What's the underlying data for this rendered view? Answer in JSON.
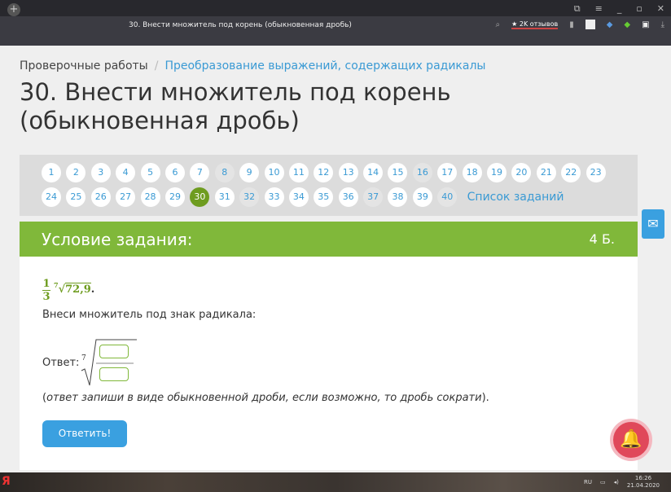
{
  "browser": {
    "tab_title": "30. Внести множитель под корень (обыкновенная дробь)",
    "reviews": "★ 2K отзывов"
  },
  "breadcrumb": {
    "root": "Проверочные работы",
    "current": "Преобразование выражений, содержащих радикалы"
  },
  "title": "30. Внести множитель под корень (обыкновенная дробь)",
  "tasks": {
    "row1": [
      "1",
      "2",
      "3",
      "4",
      "5",
      "6",
      "7",
      "8",
      "9",
      "10",
      "11",
      "12",
      "13",
      "14",
      "15",
      "16",
      "17",
      "18",
      "19",
      "20",
      "21",
      "22",
      "23"
    ],
    "row2": [
      "24",
      "25",
      "26",
      "27",
      "28",
      "29",
      "30",
      "31",
      "32",
      "33",
      "34",
      "35",
      "36",
      "37",
      "38",
      "39",
      "40"
    ],
    "grey": [
      "8",
      "16",
      "32",
      "37",
      "40"
    ],
    "active": "30",
    "list_label": "Список заданий"
  },
  "task": {
    "header": "Условие задания:",
    "points": "4 Б.",
    "frac_num": "1",
    "frac_den": "3",
    "root_index": "7",
    "radicand": "72,9",
    "period": ".",
    "question": "Внеси множитель под знак радикала:",
    "answer_label": "Ответ:",
    "note_open": "(",
    "note": "ответ запиши в виде обыкновенной дроби, если возможно, то дробь сократи",
    "note_close": ").",
    "submit": "Ответить!"
  },
  "taskbar": {
    "lang": "RU",
    "time": "16:26",
    "date": "21.04.2020"
  }
}
